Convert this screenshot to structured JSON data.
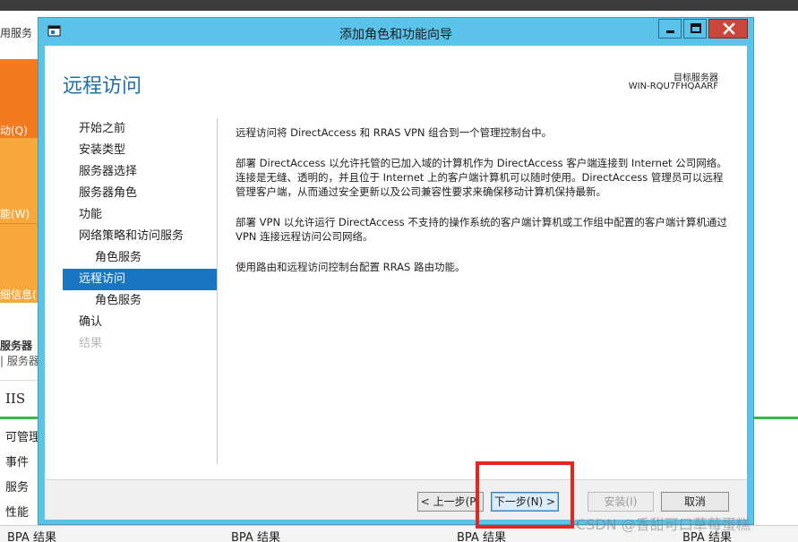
{
  "background": {
    "left_title": "用服务",
    "tiles": [
      "动(Q)",
      "能(W)",
      "细信息("
    ],
    "section_title": "服务器",
    "section_sub": "| 服务器",
    "iis_label": "IIS",
    "list_items": [
      "可管理",
      "事件",
      "服务",
      "性能"
    ],
    "bpa_labels": [
      "BPA 结果",
      "BPA 结果",
      "BPA 结果",
      "BPA 结果"
    ]
  },
  "dialog": {
    "title": "添加角色和功能向导",
    "page_title": "远程访问",
    "target_label": "目标服务器",
    "target_name": "WIN-RQU7FHQAARF",
    "nav": [
      {
        "label": "开始之前",
        "state": "normal"
      },
      {
        "label": "安装类型",
        "state": "normal"
      },
      {
        "label": "服务器选择",
        "state": "normal"
      },
      {
        "label": "服务器角色",
        "state": "normal"
      },
      {
        "label": "功能",
        "state": "normal"
      },
      {
        "label": "网络策略和访问服务",
        "state": "normal"
      },
      {
        "label": "角色服务",
        "state": "sub"
      },
      {
        "label": "远程访问",
        "state": "active"
      },
      {
        "label": "角色服务",
        "state": "sub"
      },
      {
        "label": "确认",
        "state": "normal"
      },
      {
        "label": "结果",
        "state": "disabled"
      }
    ],
    "paragraphs": [
      "远程访问将 DirectAccess 和 RRAS VPN 组合到一个管理控制台中。",
      "部署 DirectAccess 以允许托管的已加入域的计算机作为 DirectAccess 客户端连接到 Internet 公司网络。连接是无缝、透明的，并且位于 Internet 上的客户端计算机可以随时使用。DirectAccess 管理员可以远程管理客户端，从而通过安全更新以及公司兼容性要求来确保移动计算机保持最新。",
      "部署 VPN 以允许运行 DirectAccess 不支持的操作系统的客户端计算机或工作组中配置的客户端计算机通过 VPN 连接远程访问公司网络。",
      "使用路由和远程访问控制台配置 RRAS 路由功能。"
    ],
    "buttons": {
      "prev": "< 上一步(P)",
      "next": "下一步(N) >",
      "install": "安装(I)",
      "cancel": "取消"
    }
  },
  "watermark": "CSDN @香甜可口草莓蛋糕",
  "colors": {
    "titlebar": "#5bc3ea",
    "accent": "#1a75c2",
    "close": "#c9463d",
    "highlight": "#e8241c"
  }
}
